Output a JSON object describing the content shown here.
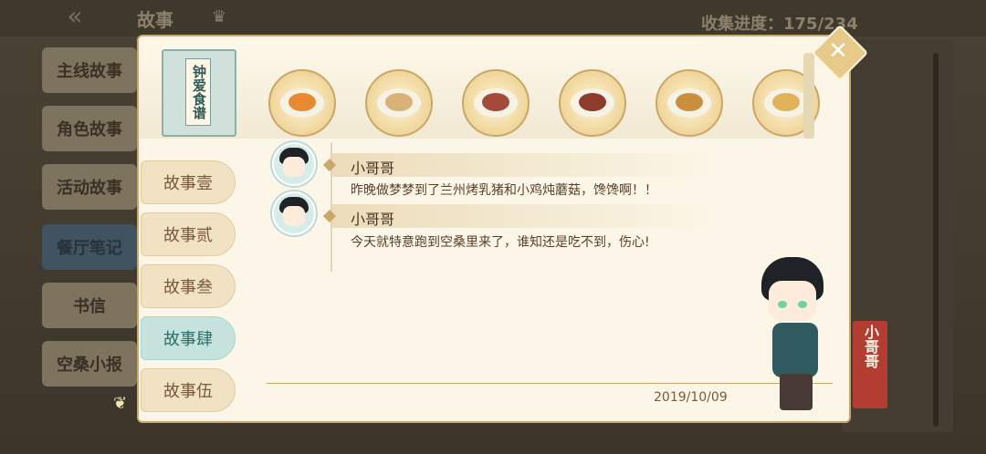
{
  "topbar": {
    "title": "故事",
    "progress": "收集进度：175/234"
  },
  "side_menu": [
    {
      "label": "主线故事"
    },
    {
      "label": "角色故事"
    },
    {
      "label": "活动故事"
    },
    {
      "label": "餐厅笔记"
    },
    {
      "label": "书信"
    },
    {
      "label": "空桑小报"
    }
  ],
  "recipe_book": {
    "label": "钟爱食谱"
  },
  "story_tabs": [
    {
      "label": "故事壹"
    },
    {
      "label": "故事贰"
    },
    {
      "label": "故事叁"
    },
    {
      "label": "故事肆"
    },
    {
      "label": "故事伍"
    }
  ],
  "messages": [
    {
      "name": "小哥哥",
      "text": "昨晚做梦梦到了兰州烤乳猪和小鸡炖蘑菇，馋馋啊！！"
    },
    {
      "name": "小哥哥",
      "text": "今天就特意跑到空桑里来了，谁知还是吃不到，伤心!"
    }
  ],
  "date": "2019/10/09",
  "character": {
    "name": "小哥哥"
  },
  "colors": {
    "panel_bg": "#fbf6e7",
    "accent_gold": "#c9a86a",
    "banner_red": "#b33d33",
    "active_tab": "#c6e3de"
  }
}
